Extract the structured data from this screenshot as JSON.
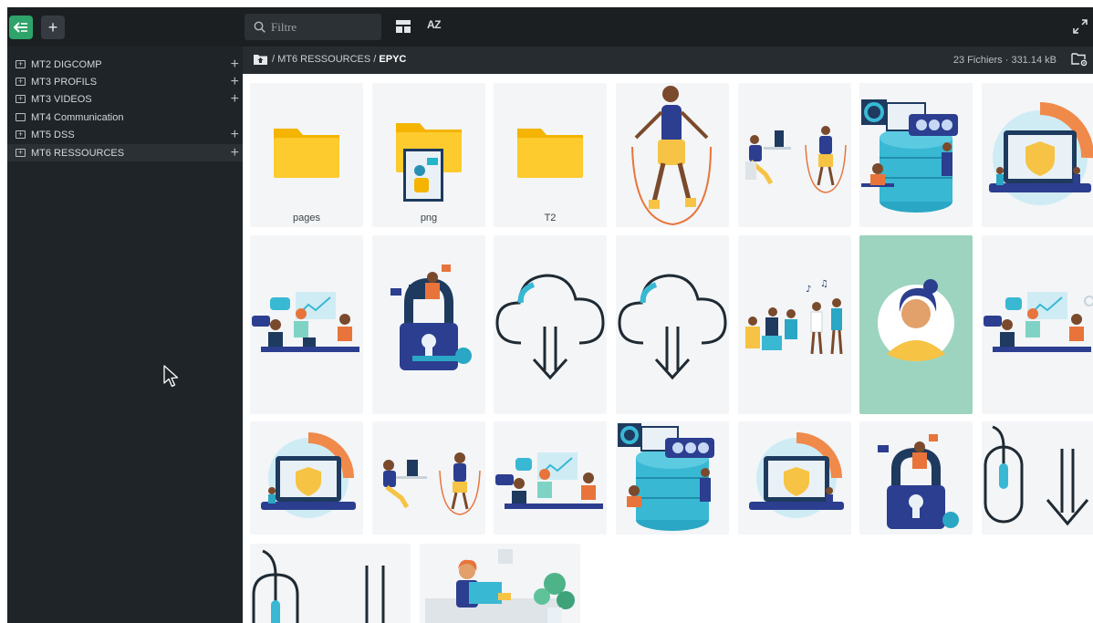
{
  "toolbar": {
    "search_placeholder": "Filtre",
    "sort_label": "AZ",
    "collapse_icon": "collapse-sidebar-icon",
    "add_icon": "plus-icon",
    "fullscreen_icon": "expand-icon",
    "accent_color": "#2ea36a"
  },
  "sidebar": {
    "items": [
      {
        "label": "MT2 DIGCOMP",
        "expandable": true
      },
      {
        "label": "MT3 PROFILS",
        "expandable": true
      },
      {
        "label": "MT3 VIDEOS",
        "expandable": true
      },
      {
        "label": "MT4 Communication",
        "expandable": false
      },
      {
        "label": "MT5 DSS",
        "expandable": true
      },
      {
        "label": "MT6 RESSOURCES",
        "expandable": true,
        "selected": true
      }
    ]
  },
  "breadcrumb": {
    "separator": "/",
    "path": [
      "MT6 RESSOURCES"
    ],
    "current": "EPYC",
    "summary": "23 Fichiers · 331.14 kB"
  },
  "grid": {
    "tiles": [
      {
        "type": "folder",
        "label": "pages"
      },
      {
        "type": "folder",
        "label": "png"
      },
      {
        "type": "folder",
        "label": "T2"
      },
      {
        "type": "image",
        "subject": "person jumping rope"
      },
      {
        "type": "image",
        "subject": "person at desk and person jumping rope"
      },
      {
        "type": "image",
        "subject": "data server team"
      },
      {
        "type": "image",
        "subject": "laptop security shield"
      },
      {
        "type": "image",
        "subject": "team meeting with chart"
      },
      {
        "type": "image",
        "subject": "padlock with person"
      },
      {
        "type": "image",
        "subject": "cloud download icon"
      },
      {
        "type": "image",
        "subject": "cloud download icon"
      },
      {
        "type": "image",
        "subject": "party crowd"
      },
      {
        "type": "image",
        "subject": "woman avatar on green"
      },
      {
        "type": "image",
        "subject": "team meeting with chart"
      },
      {
        "type": "image",
        "subject": "laptop security shield"
      },
      {
        "type": "image",
        "subject": "person at desk and person jumping rope"
      },
      {
        "type": "image",
        "subject": "team meeting with chart"
      },
      {
        "type": "image",
        "subject": "data server team"
      },
      {
        "type": "image",
        "subject": "laptop security shield"
      },
      {
        "type": "image",
        "subject": "padlock with person"
      },
      {
        "type": "image",
        "subject": "mouse scroll down icon"
      },
      {
        "type": "image",
        "subject": "mouse scroll down icon"
      },
      {
        "type": "image",
        "subject": "woman working on laptop"
      }
    ]
  }
}
